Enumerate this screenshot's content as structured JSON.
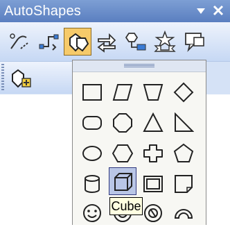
{
  "window": {
    "title": "AutoShapes"
  },
  "toolbar": {
    "row1": [
      {
        "name": "lines-button",
        "icon": "lines-icon"
      },
      {
        "name": "connectors-button",
        "icon": "connectors-icon"
      },
      {
        "name": "basic-shapes-button",
        "icon": "basic-shapes-icon",
        "state": "active"
      },
      {
        "name": "block-arrows-button",
        "icon": "block-arrows-icon"
      },
      {
        "name": "flowchart-button",
        "icon": "flowchart-icon"
      },
      {
        "name": "stars-banners-button",
        "icon": "stars-banners-icon"
      },
      {
        "name": "callouts-button",
        "icon": "callouts-icon"
      }
    ],
    "row2": [
      {
        "name": "more-autoshapes-button",
        "icon": "more-autoshapes-icon"
      }
    ]
  },
  "dropdown": {
    "name": "basic-shapes-menu",
    "shapes": [
      "rectangle",
      "parallelogram",
      "trapezoid",
      "diamond",
      "rounded-rectangle",
      "octagon",
      "triangle",
      "right-triangle",
      "oval",
      "hexagon",
      "cross",
      "pentagon",
      "can",
      "cube",
      "frame",
      "folded-corner",
      "smiley-face",
      "donut",
      "no-symbol",
      "block-arc"
    ],
    "hovered": "cube"
  },
  "tooltip": {
    "text": "Cube"
  },
  "colors": {
    "titlebar": "#6b8fcb",
    "toolbar_bg": "#d5e2f6",
    "active_button": "#f6ca6a",
    "hover_shape": "#b9c6e6",
    "tooltip_bg": "#ffffe1"
  }
}
